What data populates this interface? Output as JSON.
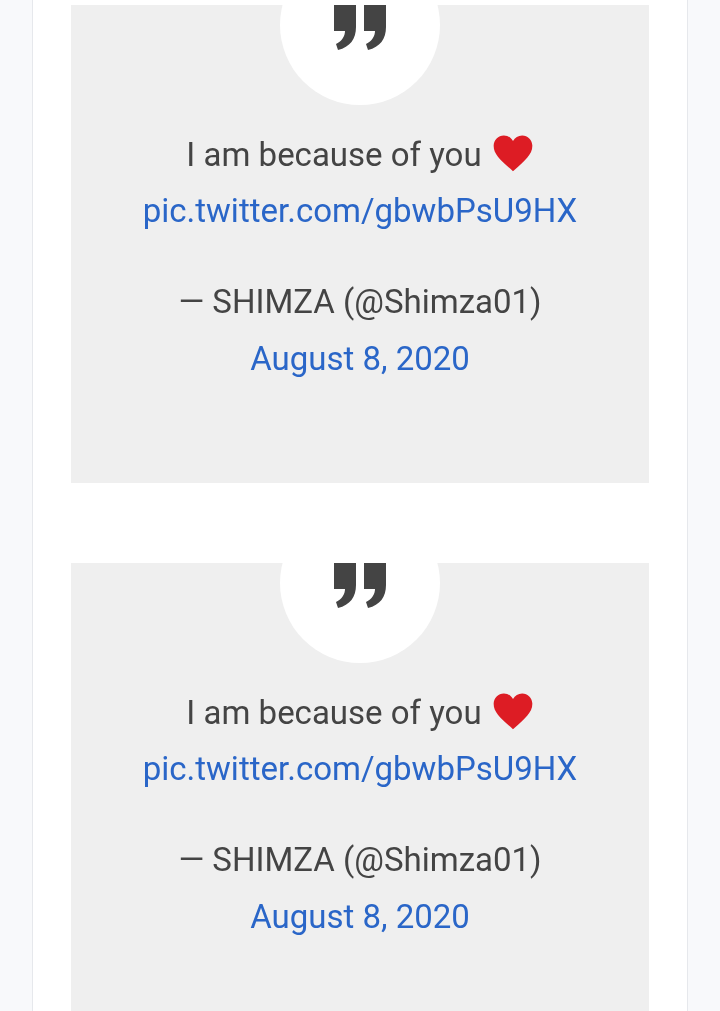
{
  "tweets": [
    {
      "text": "I am because of you",
      "link": "pic.twitter.com/gbwbPsU9HX",
      "author": "— SHIMZA (@Shimza01)",
      "date": "August 8, 2020"
    },
    {
      "text": "I am because of you",
      "link": "pic.twitter.com/gbwbPsU9HX",
      "author": "— SHIMZA (@Shimza01)",
      "date": "August 8, 2020"
    }
  ]
}
